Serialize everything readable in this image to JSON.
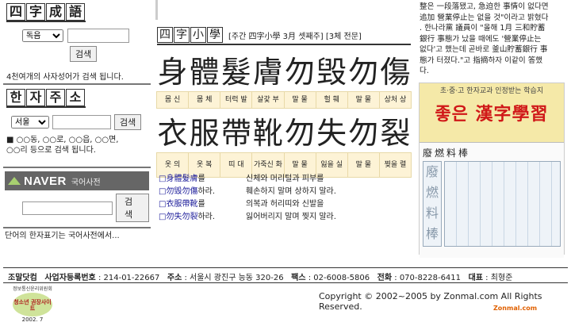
{
  "four_char": {
    "title_chars": [
      "四",
      "字",
      "成",
      "語"
    ],
    "select_value": "독음",
    "search_label": "검색",
    "info": "4천여개의 사자성어가 검색 됩니다."
  },
  "address": {
    "title_chars": [
      "한",
      "자",
      "주",
      "소"
    ],
    "select_value": "서울",
    "search_label": "검색",
    "info_line1": "■ ○○동, ○○로, ○○읍, ○○면,",
    "info_line2": "○○리 등으로 검색 됩니다."
  },
  "naver": {
    "logo": "NAVER",
    "dict": "국어사전",
    "search_label": "검색",
    "info": "단어의 한자표기는 국어사전에서..."
  },
  "weekly": {
    "title_chars": [
      "四",
      "字",
      "小",
      "學"
    ],
    "header": "[주간 四字小學 3月 셋째주] [3체 전문]",
    "row1_hanja": [
      "身",
      "體",
      "髮",
      "膚",
      "勿",
      "毁",
      "勿",
      "傷"
    ],
    "row1_mean": [
      "몸 신",
      "몸 체",
      "터럭 발",
      "살갗 부",
      "말 물",
      "헐 훼",
      "말 물",
      "상처 상"
    ],
    "row2_hanja": [
      "衣",
      "服",
      "帶",
      "靴",
      "勿",
      "失",
      "勿",
      "裂"
    ],
    "row2_mean": [
      "옷 의",
      "옷 복",
      "띠 대",
      "가죽신 화",
      "말 물",
      "잃을 실",
      "말 물",
      "찢을 렬"
    ],
    "lessons": [
      {
        "hanja": "□身體髮膚",
        "suffix": "를",
        "meaning": "신체와 머리털과 피부를"
      },
      {
        "hanja": "□勿毁勿傷",
        "suffix": "하라.",
        "meaning": "훼손하지 말며 상하지 말라."
      },
      {
        "hanja": "□衣服帶靴",
        "suffix": "를",
        "meaning": "의복과 허리띠와 신발을"
      },
      {
        "hanja": "□勿失勿裂",
        "suffix": "하라.",
        "meaning": "잃어버리지 말며 찢지 말라."
      }
    ]
  },
  "news_lines": [
    "整은 一段落됐고, 急迫한 事情이 없다면",
    "追加 營業停止는 없을 것\"이라고 밝혔다",
    ". 한나라黨 議員이 \"올해 1月 三和貯蓄",
    "銀行 事態가 났을 때에도 '營業停止는",
    "없다'고 했는데 곧바로 釜山貯蓄銀行 事",
    "態가 터졌다.\"고 指摘하자 이같이 答했",
    "다."
  ],
  "ad": {
    "top": "초·중·고 한자교과 인정받는 학습지",
    "brand": "좋은 漢字學習",
    "sheet_title": "廢燃料棒",
    "sheet_chars": [
      "廢",
      "燃",
      "料",
      "棒"
    ]
  },
  "footer": {
    "company": "조말닷컴",
    "biz_label": "사업자등록번호",
    "biz_value": ": 214-01-22667",
    "addr_label": "주소",
    "addr_value": ": 서울시 광진구 능동 320-26",
    "fax_label": "팩스",
    "fax_value": ": 02-6008-5806",
    "phone_label": "전화",
    "phone_value": ": 070-8228-6411",
    "rep_label": "대표",
    "rep_value": ": 최형준",
    "copyright": "Copyright © 2002~2005 by Zonmal.com All Rights Reserved.",
    "badge_top": "정보통신윤리위원회",
    "badge_main": "청소년 권장사이트",
    "badge_year": "2002. 7",
    "logo": "Zonmal.com"
  },
  "colors": {
    "accent_red": "#d01818",
    "hanja_blue": "#1a1a99",
    "mean_bg": "#fdf3d6",
    "naver_grey": "#666666",
    "ad_yellow": "#f5e9a8"
  }
}
